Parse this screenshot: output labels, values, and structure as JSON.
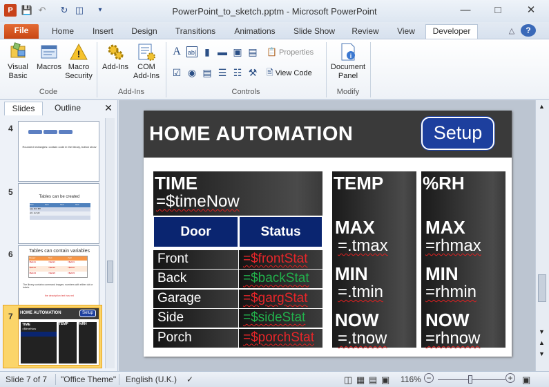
{
  "window": {
    "title": "PowerPoint_to_sketch.pptm - Microsoft PowerPoint"
  },
  "tabs": [
    "File",
    "Home",
    "Insert",
    "Design",
    "Transitions",
    "Animations",
    "Slide Show",
    "Review",
    "View",
    "Developer"
  ],
  "ribbon": {
    "code": {
      "visual_basic": "Visual Basic",
      "macros": "Macros",
      "macro_security": "Macro Security",
      "group": "Code"
    },
    "addins": {
      "add_ins": "Add-Ins",
      "com_add_ins": "COM Add-Ins",
      "group": "Add-Ins"
    },
    "controls": {
      "properties": "Properties",
      "view_code": "View Code",
      "group": "Controls"
    },
    "modify": {
      "document_panel": "Document Panel",
      "group": "Modify"
    }
  },
  "panel": {
    "tabs": [
      "Slides",
      "Outline"
    ],
    "thumbs": [
      {
        "num": "4",
        "caption": "Rounded rectangles: contain code in the library, button show"
      },
      {
        "num": "5",
        "title": "Tables can be created",
        "headers": [
          "Text",
          "Text",
          "Text",
          "Text"
        ],
        "rows": [
          [
            "aaa",
            "bbb",
            "fffff",
            ""
          ],
          [
            "abc",
            "def",
            "ghi",
            ""
          ]
        ]
      },
      {
        "num": "6",
        "title": "Tables can contain variables",
        "headers": [
          "Integer",
          "Text",
          "xVal"
        ],
        "rows": [
          [
            "=$ab11",
            "=$ab21",
            "=$ab31"
          ],
          [
            "=$ab12",
            "=$ab22",
            "=$ab32"
          ],
          [
            "=$ab13",
            "=$ab23",
            "=$ab33"
          ]
        ],
        "note": "The library contains command images: numbers with either dot or labels.",
        "red": "the description text has red"
      },
      {
        "num": "7"
      }
    ]
  },
  "slide": {
    "title": "HOME AUTOMATION",
    "setup": "Setup",
    "time_label": "TIME",
    "time_value": "=$timeNow",
    "door_header": "Door",
    "status_header": "Status",
    "doors": [
      {
        "name": "Front",
        "stat": "=$frontStat",
        "color": "#e8262a"
      },
      {
        "name": "Back",
        "stat": "=$backStat",
        "color": "#22b14c"
      },
      {
        "name": "Garage",
        "stat": "=$gargStat",
        "color": "#e8262a"
      },
      {
        "name": "Side",
        "stat": "=$sideStat",
        "color": "#22b14c"
      },
      {
        "name": "Porch",
        "stat": "=$porchStat",
        "color": "#e8262a"
      }
    ],
    "temp": {
      "label": "TEMP",
      "max": "MAX",
      "max_val": "=.tmax",
      "min": "MIN",
      "min_val": "=.tmin",
      "now": "NOW",
      "now_val": "=.tnow"
    },
    "rh": {
      "label": "%RH",
      "max": "MAX",
      "max_val": "=rhmax",
      "min": "MIN",
      "min_val": "=rhmin",
      "now": "NOW",
      "now_val": "=rhnow"
    }
  },
  "status": {
    "slide": "Slide 7 of 7",
    "theme": "\"Office Theme\"",
    "lang": "English (U.K.)",
    "zoom": "116%"
  },
  "colors": {
    "door_header": "#0a2570",
    "setup": "#1d3f9e",
    "file_tab": "#d9541f"
  }
}
